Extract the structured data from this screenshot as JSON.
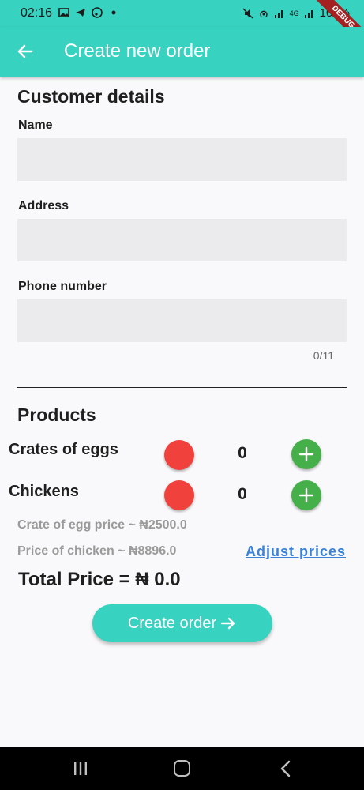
{
  "status": {
    "time": "02:16",
    "battery": "100%",
    "network": "4G",
    "debug_banner": "DEBUG"
  },
  "app_bar": {
    "title": "Create new order",
    "back_icon": "arrow-left-icon"
  },
  "customer": {
    "section_title": "Customer details",
    "name_label": "Name",
    "name_value": "",
    "address_label": "Address",
    "address_value": "",
    "phone_label": "Phone number",
    "phone_value": "",
    "phone_counter": "0/11"
  },
  "products": {
    "section_title": "Products",
    "items": [
      {
        "label": "Crates of eggs",
        "quantity": "0"
      },
      {
        "label": "Chickens",
        "quantity": "0"
      }
    ],
    "egg_price_text": "Crate of egg price ~ ₦2500.0",
    "chicken_price_text": "Price of chicken ~ ₦8896.0",
    "adjust_label": "Adjust prices"
  },
  "total": {
    "text": "Total Price = ₦ 0.0"
  },
  "actions": {
    "create_label": "Create order"
  },
  "colors": {
    "accent": "#37d2c0",
    "minus": "#f0413c",
    "plus": "#45b04a",
    "link": "#3b82d6"
  }
}
